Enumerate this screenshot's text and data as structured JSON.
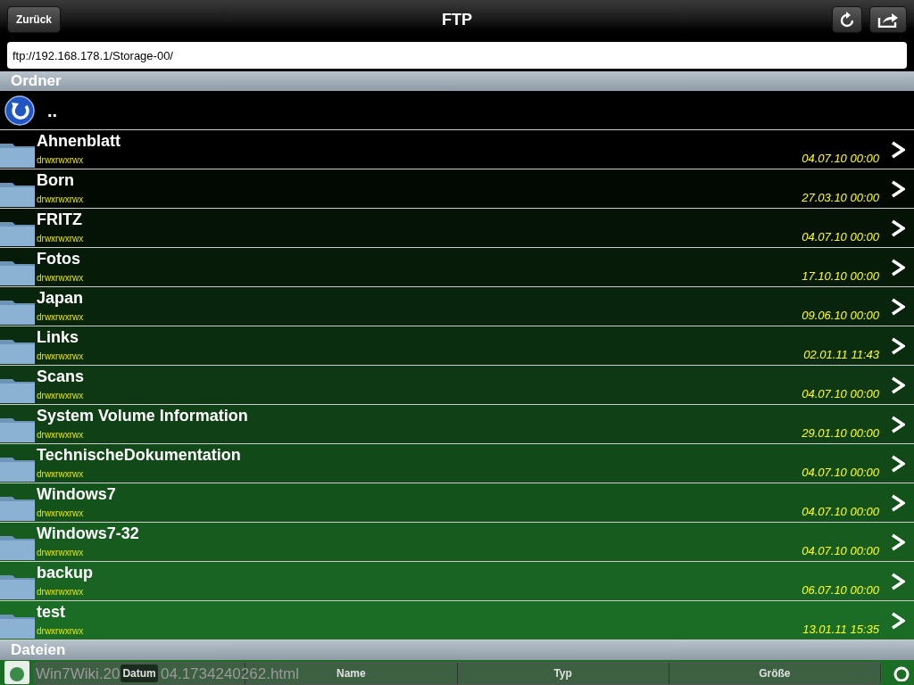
{
  "nav": {
    "back": "Zurück",
    "title": "FTP"
  },
  "address": {
    "value": "ftp://192.168.178.1/Storage-00/"
  },
  "folders_section": {
    "title": "Ordner",
    "parent": ".."
  },
  "folders": [
    {
      "name": "Ahnenblatt",
      "permissions": "drwxrwxrwx",
      "date": "04.07.10 00:00"
    },
    {
      "name": "Born",
      "permissions": "drwxrwxrwx",
      "date": "27.03.10 00:00"
    },
    {
      "name": "FRITZ",
      "permissions": "drwxrwxrwx",
      "date": "04.07.10 00:00"
    },
    {
      "name": "Fotos",
      "permissions": "drwxrwxrwx",
      "date": "17.10.10 00:00"
    },
    {
      "name": "Japan",
      "permissions": "drwxrwxrwx",
      "date": "09.06.10 00:00"
    },
    {
      "name": "Links",
      "permissions": "drwxrwxrwx",
      "date": "02.01.11 11:43"
    },
    {
      "name": "Scans",
      "permissions": "drwxrwxrwx",
      "date": "04.07.10 00:00"
    },
    {
      "name": "System Volume Information",
      "permissions": "drwxrwxrwx",
      "date": "29.01.10 00:00"
    },
    {
      "name": "TechnischeDokumentation",
      "permissions": "drwxrwxrwx",
      "date": "04.07.10 00:00"
    },
    {
      "name": "Windows7",
      "permissions": "drwxrwxrwx",
      "date": "04.07.10 00:00"
    },
    {
      "name": "Windows7-32",
      "permissions": "drwxrwxrwx",
      "date": "04.07.10 00:00"
    },
    {
      "name": "backup",
      "permissions": "drwxrwxrwx",
      "date": "06.07.10 00:00"
    },
    {
      "name": "test",
      "permissions": "drwxrwxrwx",
      "date": "13.01.11 15:35"
    }
  ],
  "files_section": {
    "title": "Dateien"
  },
  "file": {
    "name_start": "Win7Wiki.20",
    "name_end": "04.1734240262.html"
  },
  "sort": [
    {
      "label": "Datum",
      "selected": true
    },
    {
      "label": "Name",
      "selected": false
    },
    {
      "label": "Typ",
      "selected": false
    },
    {
      "label": "Größe",
      "selected": false
    }
  ]
}
